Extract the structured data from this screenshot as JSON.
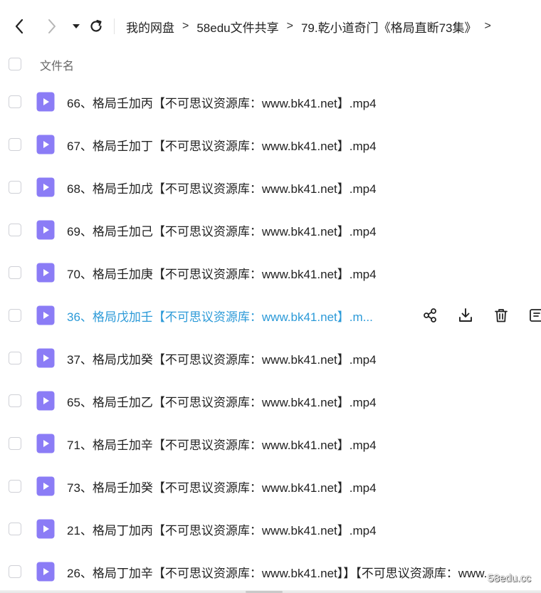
{
  "toolbar": {
    "back_icon": "chevron-left-icon",
    "forward_icon": "chevron-right-icon",
    "history_icon": "caret-down-icon",
    "refresh_icon": "refresh-icon"
  },
  "breadcrumb": {
    "items": [
      "我的网盘",
      "58edu文件共享",
      "79.乾小道奇门《格局直断73集》"
    ],
    "separator": ">"
  },
  "header": {
    "name_column": "文件名"
  },
  "files": [
    {
      "name": "66、格局壬加丙【不可思议资源库：www.bk41.net】.mp4"
    },
    {
      "name": "67、格局壬加丁【不可思议资源库：www.bk41.net】.mp4"
    },
    {
      "name": "68、格局壬加戊【不可思议资源库：www.bk41.net】.mp4"
    },
    {
      "name": "69、格局壬加己【不可思议资源库：www.bk41.net】.mp4"
    },
    {
      "name": "70、格局壬加庚【不可思议资源库：www.bk41.net】.mp4"
    },
    {
      "name": "36、格局戊加壬【不可思议资源库：www.bk41.net】.m..."
    },
    {
      "name": "37、格局戊加癸【不可思议资源库：www.bk41.net】.mp4"
    },
    {
      "name": "65、格局壬加乙【不可思议资源库：www.bk41.net】.mp4"
    },
    {
      "name": "71、格局壬加辛【不可思议资源库：www.bk41.net】.mp4"
    },
    {
      "name": "73、格局壬加癸【不可思议资源库：www.bk41.net】.mp4"
    },
    {
      "name": "21、格局丁加丙【不可思议资源库：www.bk41.net】.mp4"
    },
    {
      "name": "26、格局丁加辛【不可思议资源库：www.bk41.net】】【不可思议资源库：www."
    }
  ],
  "row_actions": [
    "share-icon",
    "download-icon",
    "delete-icon",
    "more-icon"
  ],
  "colors": {
    "accent": "#2c9ad8",
    "file_icon": "#8b7cf6",
    "checkbox_border": "#cfd0d6"
  },
  "watermark": "58edu.cc"
}
